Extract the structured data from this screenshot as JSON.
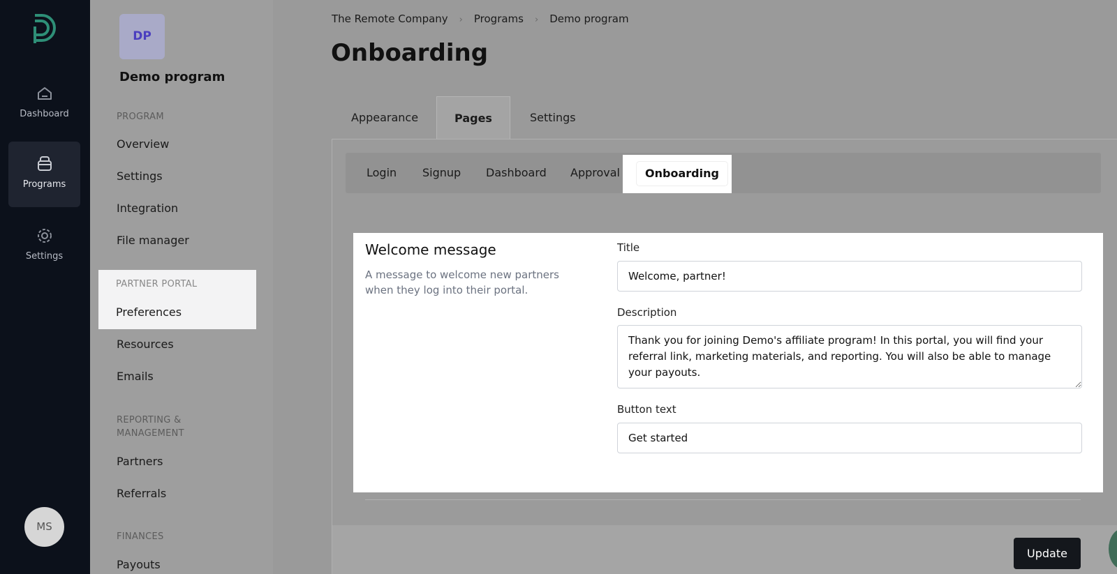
{
  "rail": {
    "items": [
      {
        "label": "Dashboard",
        "icon": "home-icon"
      },
      {
        "label": "Programs",
        "icon": "programs-icon"
      },
      {
        "label": "Settings",
        "icon": "gear-icon"
      }
    ],
    "avatar": "MS",
    "accent_color": "#2e8f77"
  },
  "program_sidebar": {
    "avatar": "DP",
    "program_name": "Demo program",
    "sections": {
      "program": "PROGRAM",
      "partner_portal": "PARTNER PORTAL",
      "reporting_line1": "REPORTING &",
      "reporting_line2": "MANAGEMENT",
      "finances": "FINANCES"
    },
    "items": {
      "overview": "Overview",
      "settings": "Settings",
      "integration": "Integration",
      "file_manager": "File manager",
      "preferences": "Preferences",
      "resources": "Resources",
      "emails": "Emails",
      "partners": "Partners",
      "referrals": "Referrals",
      "payouts": "Payouts"
    }
  },
  "breadcrumb": [
    "The Remote Company",
    "Programs",
    "Demo program"
  ],
  "breadcrumb_sep": "›",
  "page_title": "Onboarding",
  "tabs": [
    "Appearance",
    "Pages",
    "Settings"
  ],
  "subtabs": [
    "Login",
    "Signup",
    "Dashboard",
    "Approval",
    "Onboarding"
  ],
  "card": {
    "title": "Welcome message",
    "description": "A message to welcome new partners when they log into their portal.",
    "fields": {
      "title_label": "Title",
      "title_value": "Welcome, partner!",
      "description_label": "Description",
      "description_value": "Thank you for joining Demo's affiliate program! In this portal, you will find your referral link, marketing materials, and reporting. You will also be able to manage your payouts.",
      "button_text_label": "Button text",
      "button_text_value": "Get started"
    }
  },
  "update_label": "Update"
}
